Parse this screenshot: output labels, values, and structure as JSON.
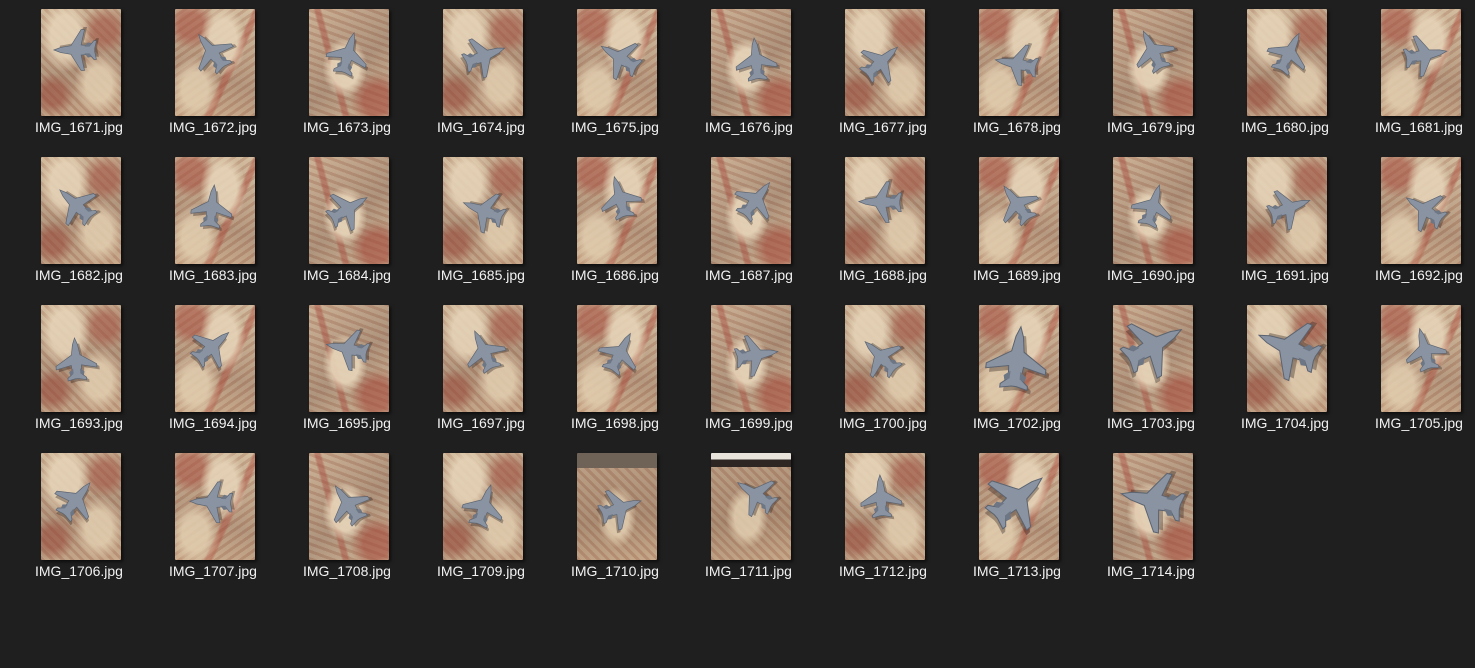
{
  "window": {
    "view": "large-icons"
  },
  "files": [
    {
      "name": "IMG_1671.jpg",
      "icon": "image-thumbnail-icon"
    },
    {
      "name": "IMG_1672.jpg",
      "icon": "image-thumbnail-icon"
    },
    {
      "name": "IMG_1673.jpg",
      "icon": "image-thumbnail-icon"
    },
    {
      "name": "IMG_1674.jpg",
      "icon": "image-thumbnail-icon"
    },
    {
      "name": "IMG_1675.jpg",
      "icon": "image-thumbnail-icon"
    },
    {
      "name": "IMG_1676.jpg",
      "icon": "image-thumbnail-icon"
    },
    {
      "name": "IMG_1677.jpg",
      "icon": "image-thumbnail-icon"
    },
    {
      "name": "IMG_1678.jpg",
      "icon": "image-thumbnail-icon"
    },
    {
      "name": "IMG_1679.jpg",
      "icon": "image-thumbnail-icon"
    },
    {
      "name": "IMG_1680.jpg",
      "icon": "image-thumbnail-icon"
    },
    {
      "name": "IMG_1681.jpg",
      "icon": "image-thumbnail-icon"
    },
    {
      "name": "IMG_1682.jpg",
      "icon": "image-thumbnail-icon"
    },
    {
      "name": "IMG_1683.jpg",
      "icon": "image-thumbnail-icon"
    },
    {
      "name": "IMG_1684.jpg",
      "icon": "image-thumbnail-icon"
    },
    {
      "name": "IMG_1685.jpg",
      "icon": "image-thumbnail-icon"
    },
    {
      "name": "IMG_1686.jpg",
      "icon": "image-thumbnail-icon"
    },
    {
      "name": "IMG_1687.jpg",
      "icon": "image-thumbnail-icon"
    },
    {
      "name": "IMG_1688.jpg",
      "icon": "image-thumbnail-icon"
    },
    {
      "name": "IMG_1689.jpg",
      "icon": "image-thumbnail-icon"
    },
    {
      "name": "IMG_1690.jpg",
      "icon": "image-thumbnail-icon"
    },
    {
      "name": "IMG_1691.jpg",
      "icon": "image-thumbnail-icon"
    },
    {
      "name": "IMG_1692.jpg",
      "icon": "image-thumbnail-icon"
    },
    {
      "name": "IMG_1693.jpg",
      "icon": "image-thumbnail-icon"
    },
    {
      "name": "IMG_1694.jpg",
      "icon": "image-thumbnail-icon"
    },
    {
      "name": "IMG_1695.jpg",
      "icon": "image-thumbnail-icon"
    },
    {
      "name": "IMG_1697.jpg",
      "icon": "image-thumbnail-icon"
    },
    {
      "name": "IMG_1698.jpg",
      "icon": "image-thumbnail-icon"
    },
    {
      "name": "IMG_1699.jpg",
      "icon": "image-thumbnail-icon"
    },
    {
      "name": "IMG_1700.jpg",
      "icon": "image-thumbnail-icon"
    },
    {
      "name": "IMG_1702.jpg",
      "icon": "image-thumbnail-icon"
    },
    {
      "name": "IMG_1703.jpg",
      "icon": "image-thumbnail-icon"
    },
    {
      "name": "IMG_1704.jpg",
      "icon": "image-thumbnail-icon"
    },
    {
      "name": "IMG_1705.jpg",
      "icon": "image-thumbnail-icon"
    },
    {
      "name": "IMG_1706.jpg",
      "icon": "image-thumbnail-icon"
    },
    {
      "name": "IMG_1707.jpg",
      "icon": "image-thumbnail-icon"
    },
    {
      "name": "IMG_1708.jpg",
      "icon": "image-thumbnail-icon"
    },
    {
      "name": "IMG_1709.jpg",
      "icon": "image-thumbnail-icon"
    },
    {
      "name": "IMG_1710.jpg",
      "icon": "image-thumbnail-icon"
    },
    {
      "name": "IMG_1711.jpg",
      "icon": "image-thumbnail-icon"
    },
    {
      "name": "IMG_1712.jpg",
      "icon": "image-thumbnail-icon"
    },
    {
      "name": "IMG_1713.jpg",
      "icon": "image-thumbnail-icon"
    },
    {
      "name": "IMG_1714.jpg",
      "icon": "image-thumbnail-icon"
    }
  ],
  "colors": {
    "background": "#1f1f1f",
    "label_text": "#f2f2f2",
    "jet": "#8a93a1",
    "carpet_light": "#e3cfae",
    "carpet_red": "#a24c3c"
  }
}
